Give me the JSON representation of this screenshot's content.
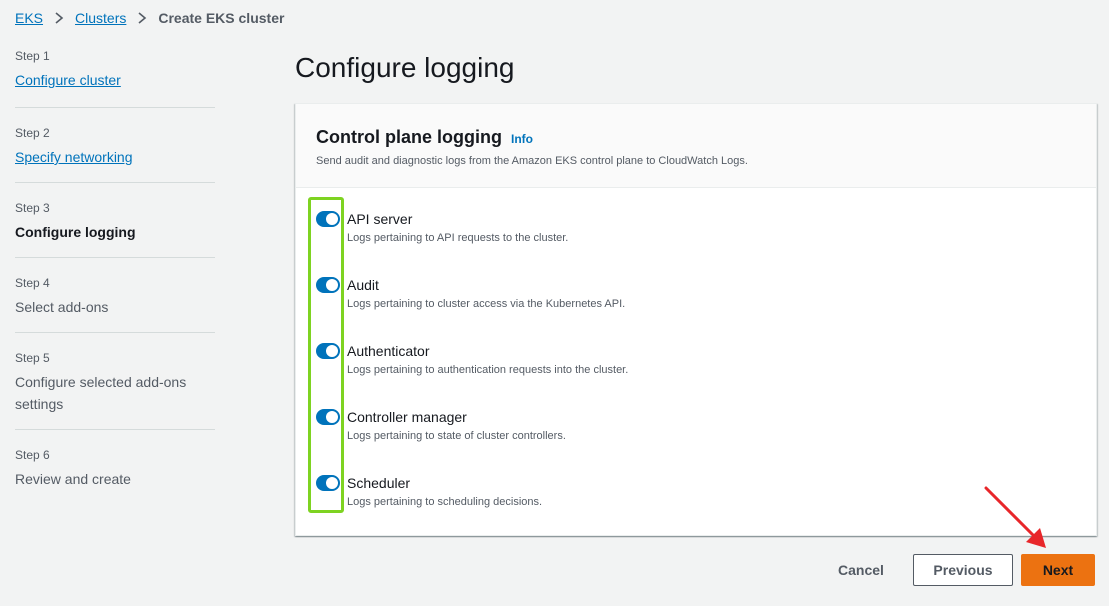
{
  "breadcrumb": {
    "items": [
      {
        "label": "EKS"
      },
      {
        "label": "Clusters"
      }
    ],
    "current": "Create EKS cluster"
  },
  "steps": [
    {
      "number": "Step 1",
      "title": "Configure cluster",
      "state": "link"
    },
    {
      "number": "Step 2",
      "title": "Specify networking",
      "state": "link"
    },
    {
      "number": "Step 3",
      "title": "Configure logging",
      "state": "current"
    },
    {
      "number": "Step 4",
      "title": "Select add-ons",
      "state": "plain"
    },
    {
      "number": "Step 5",
      "title": "Configure selected add-ons settings",
      "state": "plain"
    },
    {
      "number": "Step 6",
      "title": "Review and create",
      "state": "plain"
    }
  ],
  "page": {
    "title": "Configure logging"
  },
  "panel": {
    "title": "Control plane logging",
    "info": "Info",
    "description": "Send audit and diagnostic logs from the Amazon EKS control plane to CloudWatch Logs.",
    "toggles": [
      {
        "label": "API server",
        "description": "Logs pertaining to API requests to the cluster.",
        "on": true
      },
      {
        "label": "Audit",
        "description": "Logs pertaining to cluster access via the Kubernetes API.",
        "on": true
      },
      {
        "label": "Authenticator",
        "description": "Logs pertaining to authentication requests into the cluster.",
        "on": true
      },
      {
        "label": "Controller manager",
        "description": "Logs pertaining to state of cluster controllers.",
        "on": true
      },
      {
        "label": "Scheduler",
        "description": "Logs pertaining to scheduling decisions.",
        "on": true
      }
    ]
  },
  "footer": {
    "cancel": "Cancel",
    "previous": "Previous",
    "next": "Next"
  },
  "colors": {
    "link": "#0073bb",
    "toggle_on": "#0073bb",
    "primary_button": "#ec7211",
    "highlight": "#7ed321",
    "annotation_arrow": "#e8262a"
  }
}
